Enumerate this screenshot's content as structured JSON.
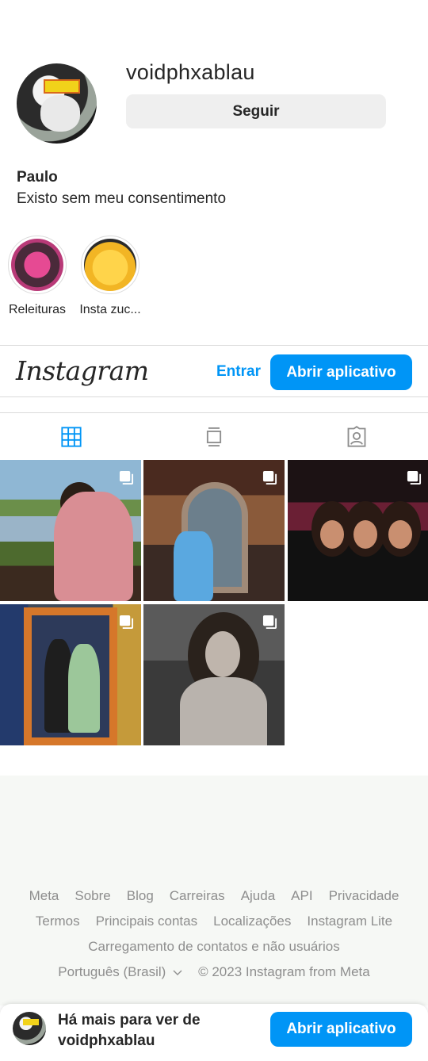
{
  "profile": {
    "username": "voidphxablau",
    "follow_label": "Seguir",
    "full_name": "Paulo",
    "bio": "Existo sem meu consentimento"
  },
  "highlights": [
    {
      "label": "Releituras"
    },
    {
      "label": "Insta zuc..."
    }
  ],
  "app_bar": {
    "logo": "Instagram",
    "login_label": "Entrar",
    "open_app_label": "Abrir aplicativo"
  },
  "tabs": [
    {
      "name": "posts-grid",
      "icon": "grid-icon",
      "active": true
    },
    {
      "name": "feed",
      "icon": "feed-icon",
      "active": false
    },
    {
      "name": "tagged",
      "icon": "tagged-user-icon",
      "active": false
    }
  ],
  "posts": [
    {
      "icon": "multiple-photos-icon"
    },
    {
      "icon": "multiple-photos-icon"
    },
    {
      "icon": "multiple-photos-icon"
    },
    {
      "icon": "multiple-photos-icon"
    },
    {
      "icon": "multiple-photos-icon"
    }
  ],
  "footer": {
    "row1": [
      "Meta",
      "Sobre",
      "Blog",
      "Carreiras",
      "Ajuda",
      "API",
      "Privacidade"
    ],
    "row2": [
      "Termos",
      "Principais contas",
      "Localizações",
      "Instagram Lite"
    ],
    "row3": "Carregamento de contatos e não usuários",
    "language": "Português (Brasil)",
    "copyright": "© 2023 Instagram from Meta"
  },
  "banner": {
    "text_line1": "Há mais para ver de",
    "text_line2": "voidphxablau",
    "button_label": "Abrir aplicativo"
  },
  "colors": {
    "accent": "#0095f6",
    "text": "#262626",
    "muted": "#8e8e8e",
    "button_bg": "#efefef",
    "footer_bg": "#f6f8f5"
  }
}
